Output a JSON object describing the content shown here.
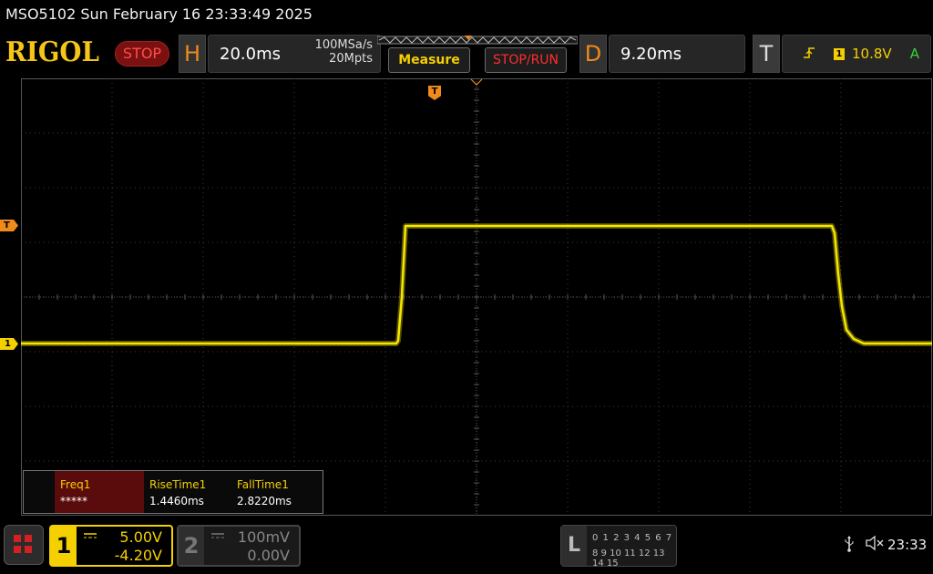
{
  "title_bar": {
    "text": "MSO5102  Sun February 16 23:33:49 2025"
  },
  "header": {
    "logo": "RIGOL",
    "run_state": "STOP",
    "horizontal": {
      "letter": "H",
      "timebase": "20.0ms",
      "sample_rate": "100MSa/s",
      "memory_depth": "20Mpts"
    },
    "measure_button": "Measure",
    "stop_run_button": "STOP/RUN",
    "delay": {
      "letter": "D",
      "value": "9.20ms"
    },
    "trigger": {
      "letter": "T",
      "edge_icon": "rising-edge-icon",
      "source": "1",
      "level": "10.8V",
      "mode": "A"
    }
  },
  "screen": {
    "trigger_level_marker": "T",
    "channel1_marker": "1",
    "trigger_position_marker": "T",
    "trace_color": "#f5e600",
    "grid_color": "#3c3c3c"
  },
  "measurements": [
    {
      "name": "Freq1",
      "value": "*****"
    },
    {
      "name": "RiseTime1",
      "value": "1.4460ms"
    },
    {
      "name": "FallTime1",
      "value": "2.8220ms"
    }
  ],
  "footer": {
    "home_icon": "grid-menu-icon",
    "ch1": {
      "number": "1",
      "coupling": "DC",
      "scale": "5.00V",
      "offset": "-4.20V",
      "color": "#f5d000"
    },
    "ch2": {
      "number": "2",
      "coupling": "DC",
      "scale": "100mV",
      "offset": "0.00V",
      "color": "#888888"
    },
    "logic": {
      "label": "L",
      "row1": "0 1 2 3  4 5 6 7",
      "row2": "8  9 10 11 12 13 14 15"
    },
    "usb_icon": "usb-icon",
    "mute_icon": "speaker-mute-icon",
    "clock": "23:33"
  }
}
